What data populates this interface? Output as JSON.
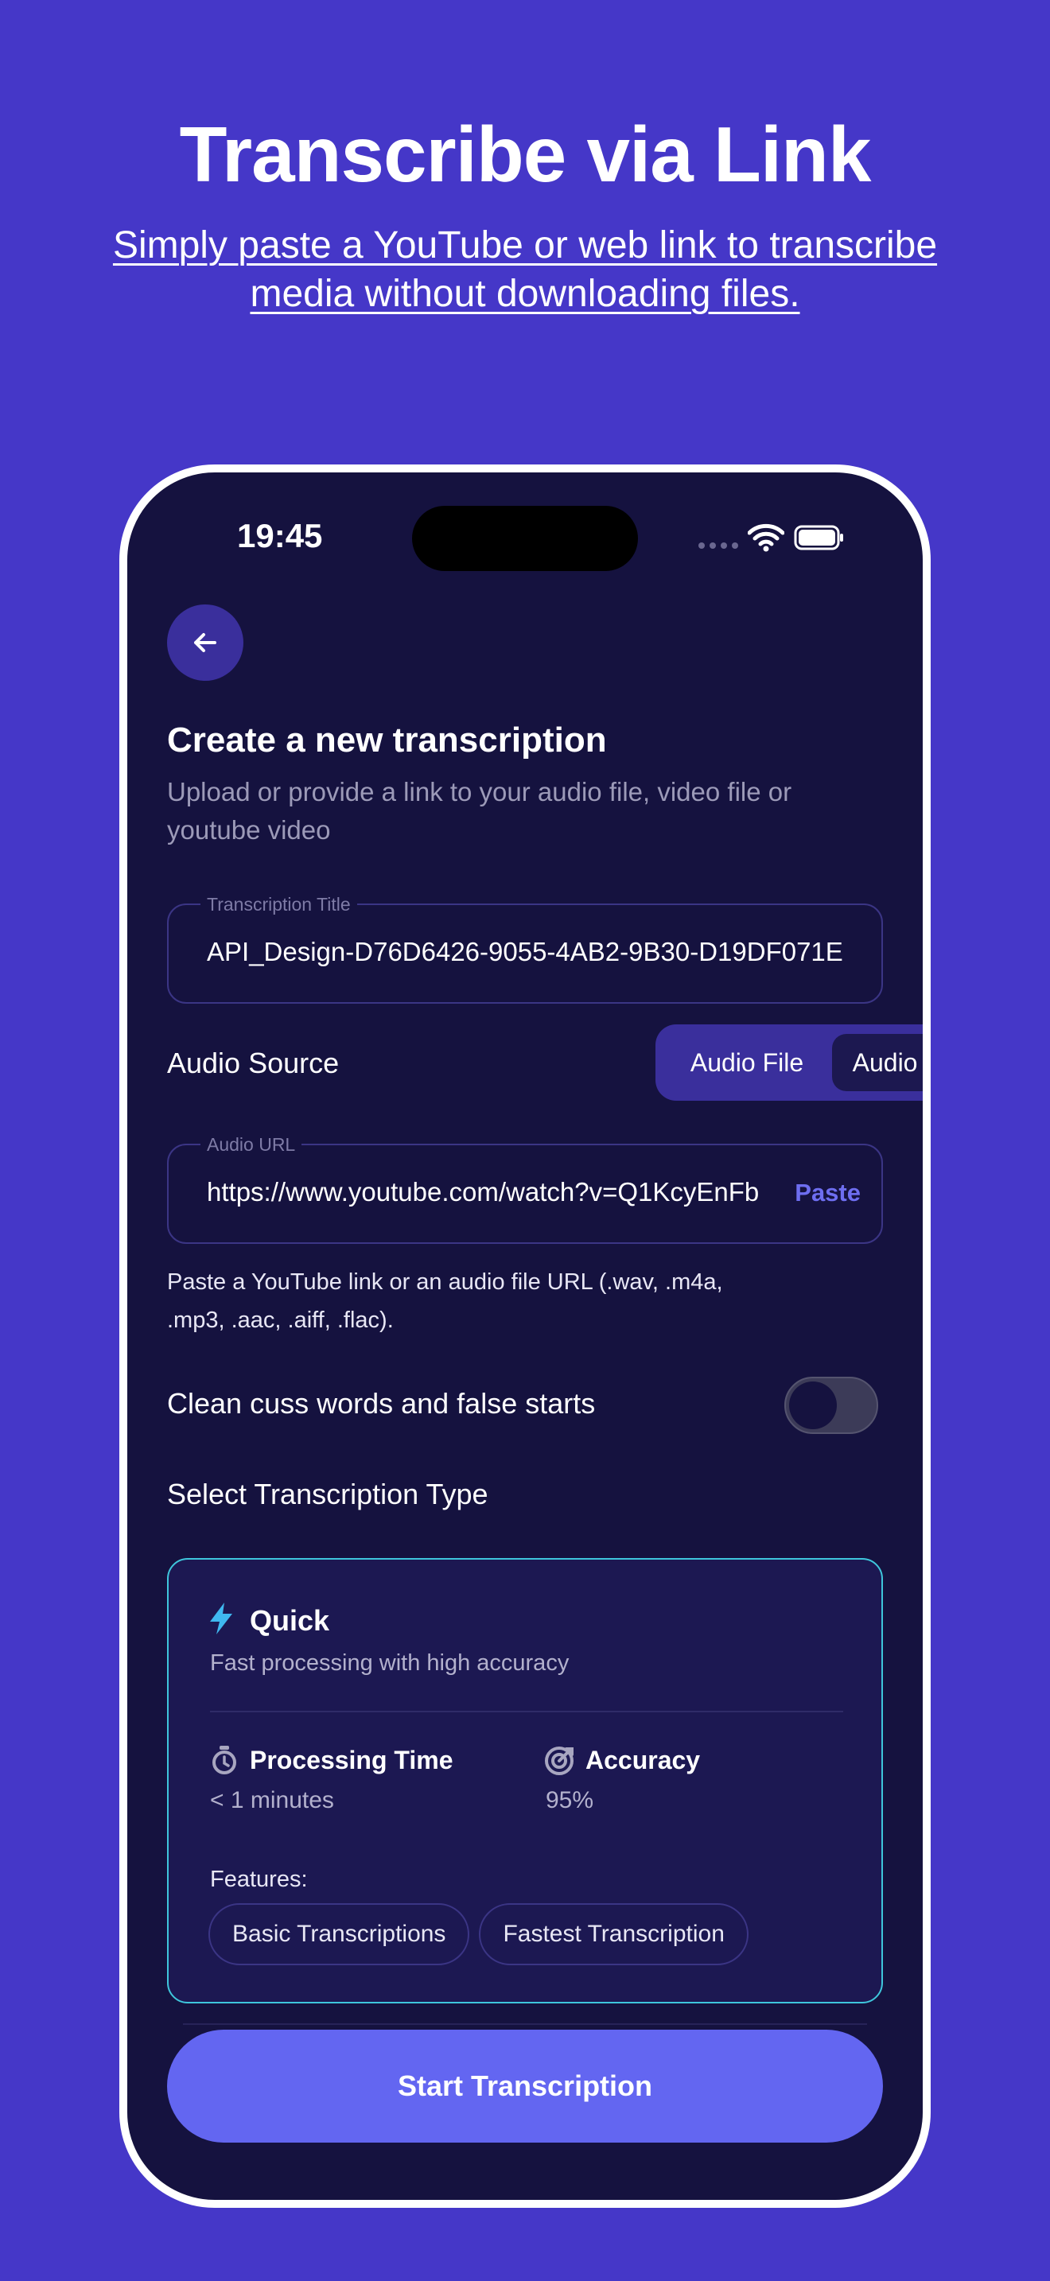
{
  "hero": {
    "title": "Transcribe via Link",
    "subtitle": "Simply paste a YouTube or web link to transcribe media without downloading files."
  },
  "status_bar": {
    "time": "19:45",
    "icons": [
      "signal-dots-icon",
      "wifi-icon",
      "battery-icon"
    ]
  },
  "header": {
    "back_icon": "arrow-left-icon",
    "title": "Create a new transcription",
    "subtitle": "Upload or provide a link to your audio file, video file or youtube video"
  },
  "title_field": {
    "label": "Transcription Title",
    "value": "API_Design-D76D6426-9055-4AB2-9B30-D19DF071E"
  },
  "audio_source": {
    "label": "Audio Source",
    "options": [
      "Audio File",
      "Audio URL"
    ],
    "selected": "Audio URL"
  },
  "url_field": {
    "label": "Audio URL",
    "value": "https://www.youtube.com/watch?v=Q1KcyEnFb",
    "paste_label": "Paste",
    "hint": "Paste a YouTube link or an audio file URL (.wav, .m4a, .mp3, .aac, .aiff, .flac)."
  },
  "clean_option": {
    "label": "Clean cuss words and false starts",
    "enabled": false
  },
  "transcription_type": {
    "section_label": "Select Transcription Type",
    "card": {
      "icon": "lightning-bolt-icon",
      "title": "Quick",
      "subtitle": "Fast processing with high accuracy",
      "processing_time_label": "Processing Time",
      "processing_time_value": "< 1 minutes",
      "accuracy_label": "Accuracy",
      "accuracy_value": "95%",
      "features_label": "Features:",
      "features": [
        "Basic Transcriptions",
        "Fastest Transcription"
      ]
    }
  },
  "start_button": "Start Transcription",
  "colors": {
    "background": "#4537c8",
    "phone_screen": "#15123f",
    "accent": "#6366f1",
    "card_border": "#3fc6dc",
    "segment_bg": "#3a2f9c"
  }
}
